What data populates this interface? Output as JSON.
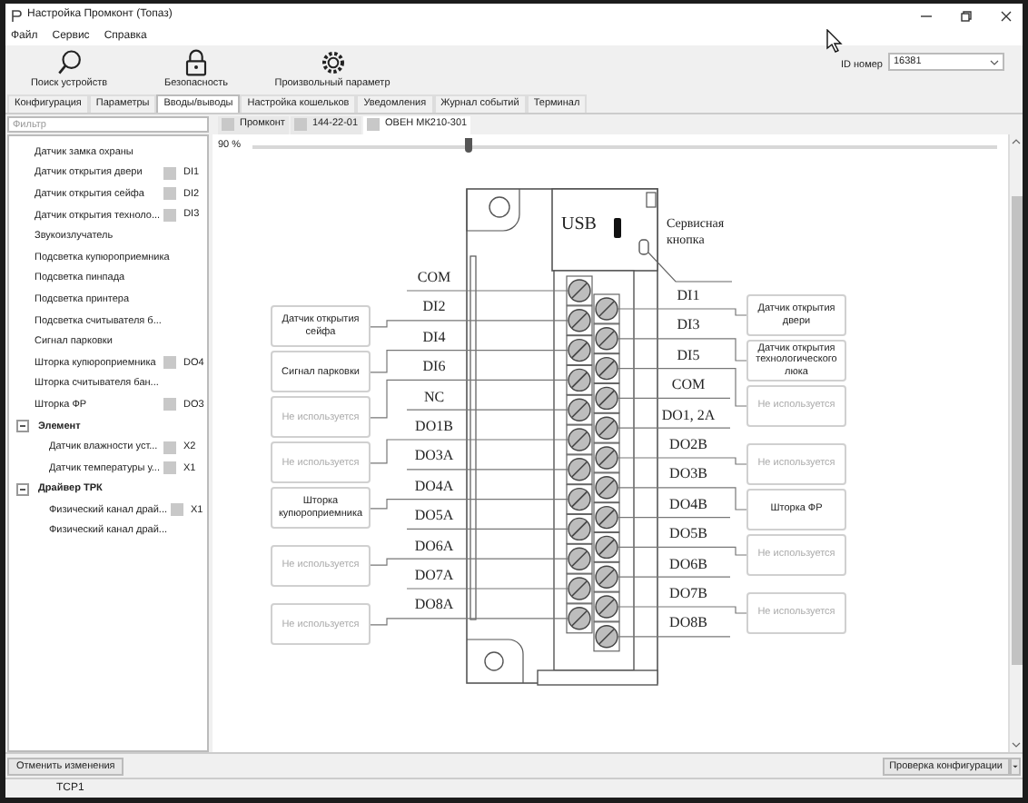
{
  "window": {
    "title": "Настройка Промконт (Топаз)"
  },
  "menu": [
    "Файл",
    "Сервис",
    "Справка"
  ],
  "toolbar": [
    {
      "kind": "search",
      "label": "Поиск устройств"
    },
    {
      "kind": "lock",
      "label": "Безопасность"
    },
    {
      "kind": "param",
      "label": "Произвольный параметр"
    }
  ],
  "id_field": {
    "label": "ID номер",
    "value": "16381"
  },
  "tabs": [
    {
      "label": "Конфигурация",
      "selected": false
    },
    {
      "label": "Параметры",
      "selected": false
    },
    {
      "label": "Вводы/выводы",
      "selected": true
    },
    {
      "label": "Настройка кошельков",
      "selected": false
    },
    {
      "label": "Уведомления",
      "selected": false
    },
    {
      "label": "Журнал событий",
      "selected": false
    },
    {
      "label": "Терминал",
      "selected": false
    }
  ],
  "filter": {
    "placeholder": "Фильтр"
  },
  "tree": [
    {
      "label": "Датчик замка охраны"
    },
    {
      "label": "Датчик открытия двери",
      "tag": "DI1"
    },
    {
      "label": "Датчик открытия сейфа",
      "tag": "DI2"
    },
    {
      "label": "Датчик открытия техноло...",
      "tag": "DI3"
    },
    {
      "label": "Звукоизлучатель"
    },
    {
      "label": "Подсветка купюроприемника"
    },
    {
      "label": "Подсветка пинпада"
    },
    {
      "label": "Подсветка принтера"
    },
    {
      "label": "Подсветка считывателя б..."
    },
    {
      "label": "Сигнал парковки"
    },
    {
      "label": "Шторка купюроприемника",
      "tag": "DO4"
    },
    {
      "label": "Шторка считывателя бан..."
    },
    {
      "label": "Шторка ФР",
      "tag": "DO3"
    },
    {
      "kind": "group",
      "label": "Элемент",
      "expanded": true,
      "children": [
        {
          "label": "Датчик влажности уст...",
          "tag": "X2"
        },
        {
          "label": "Датчик температуры у...",
          "tag": "X1"
        }
      ]
    },
    {
      "kind": "group",
      "label": "Драйвер ТРК",
      "expanded": true,
      "children": [
        {
          "label": "Физический канал драй...",
          "tag": "X1"
        },
        {
          "label": "Физический канал драй..."
        }
      ]
    }
  ],
  "device_tabs": [
    {
      "label": "Промконт",
      "selected": false
    },
    {
      "label": "144-22-01",
      "selected": false
    },
    {
      "label": "ОВЕН МК210-301",
      "selected": true
    }
  ],
  "zoom": {
    "reading": "90 %",
    "level": 0.29
  },
  "diagram": {
    "usb": "USB",
    "service_button": "Сервисная кнопка",
    "left": [
      {
        "label": "COM"
      },
      {
        "label": "DI2",
        "signal": {
          "text": "Датчик открытия сейфа",
          "used": true
        }
      },
      {
        "label": "DI4",
        "signal": {
          "text": "Сигнал парковки",
          "used": true
        }
      },
      {
        "label": "DI6",
        "signal": {
          "text": "Не используется",
          "used": false
        }
      },
      {
        "label": "NC"
      },
      {
        "label": "DO1B",
        "signal": {
          "text": "Не используется",
          "used": false
        }
      },
      {
        "label": "DO3A"
      },
      {
        "label": "DO4A",
        "signal": {
          "text": "Шторка купюроприемника",
          "used": true
        }
      },
      {
        "label": "DO5A"
      },
      {
        "label": "DO6A",
        "signal": {
          "text": "Не используется",
          "used": false
        }
      },
      {
        "label": "DO7A"
      },
      {
        "label": "DO8A",
        "signal": {
          "text": "Не используется",
          "used": false
        }
      }
    ],
    "right": [
      {
        "label": "DI1",
        "signal": {
          "text": "Датчик открытия двери",
          "used": true
        }
      },
      {
        "label": "DI3",
        "signal": {
          "text": "Датчик открытия технологического люка",
          "used": true
        }
      },
      {
        "label": "DI5",
        "signal": {
          "text": "Не используется",
          "used": false
        }
      },
      {
        "label": "COM"
      },
      {
        "label": "DO1, 2A"
      },
      {
        "label": "DO2B",
        "signal": {
          "text": "Не используется",
          "used": false
        }
      },
      {
        "label": "DO3B",
        "signal": {
          "text": "Шторка ФР",
          "used": true
        }
      },
      {
        "label": "DO4B"
      },
      {
        "label": "DO5B",
        "signal": {
          "text": "Не используется",
          "used": false
        }
      },
      {
        "label": "DO6B"
      },
      {
        "label": "DO7B",
        "signal": {
          "text": "Не используется",
          "used": false
        }
      },
      {
        "label": "DO8B"
      }
    ]
  },
  "footer": {
    "cancel": "Отменить изменения",
    "check": "Проверка конфигурации"
  },
  "status_bar": "TCP1"
}
